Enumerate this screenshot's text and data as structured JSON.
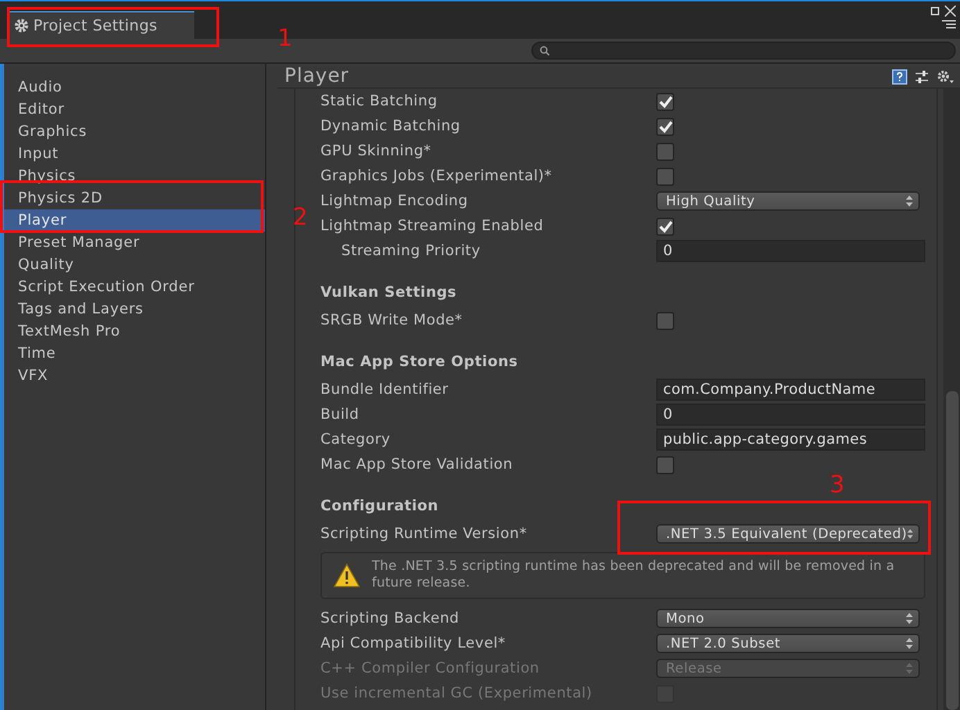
{
  "window": {
    "tab": "Project Settings"
  },
  "sidebar": {
    "items": [
      {
        "label": "Audio",
        "selected": false
      },
      {
        "label": "Editor",
        "selected": false
      },
      {
        "label": "Graphics",
        "selected": false
      },
      {
        "label": "Input",
        "selected": false
      },
      {
        "label": "Physics",
        "selected": false
      },
      {
        "label": "Physics 2D",
        "selected": false
      },
      {
        "label": "Player",
        "selected": true
      },
      {
        "label": "Preset Manager",
        "selected": false
      },
      {
        "label": "Quality",
        "selected": false
      },
      {
        "label": "Script Execution Order",
        "selected": false
      },
      {
        "label": "Tags and Layers",
        "selected": false
      },
      {
        "label": "TextMesh Pro",
        "selected": false
      },
      {
        "label": "Time",
        "selected": false
      },
      {
        "label": "VFX",
        "selected": false
      }
    ]
  },
  "inspector": {
    "title": "Player",
    "rows": [
      {
        "kind": "checkbox",
        "label": "Static Batching",
        "checked": true,
        "disabled": false
      },
      {
        "kind": "checkbox",
        "label": "Dynamic Batching",
        "checked": true,
        "disabled": false
      },
      {
        "kind": "checkbox",
        "label": "GPU Skinning*",
        "checked": false,
        "disabled": false
      },
      {
        "kind": "checkbox",
        "label": "Graphics Jobs (Experimental)*",
        "checked": false,
        "disabled": false
      },
      {
        "kind": "dropdown",
        "label": "Lightmap Encoding",
        "value": "High Quality",
        "disabled": false
      },
      {
        "kind": "checkbox",
        "label": "Lightmap Streaming Enabled",
        "checked": true,
        "disabled": false
      },
      {
        "kind": "text",
        "label": "Streaming Priority",
        "value": "0",
        "indented": true,
        "disabled": false
      },
      {
        "kind": "header",
        "label": "Vulkan Settings"
      },
      {
        "kind": "checkbox",
        "label": "SRGB Write Mode*",
        "checked": false,
        "disabled": false
      },
      {
        "kind": "header",
        "label": "Mac App Store Options"
      },
      {
        "kind": "text",
        "label": "Bundle Identifier",
        "value": "com.Company.ProductName",
        "disabled": false
      },
      {
        "kind": "text",
        "label": "Build",
        "value": "0",
        "disabled": false
      },
      {
        "kind": "text",
        "label": "Category",
        "value": "public.app-category.games",
        "disabled": false
      },
      {
        "kind": "checkbox",
        "label": "Mac App Store Validation",
        "checked": false,
        "disabled": false
      },
      {
        "kind": "header",
        "label": "Configuration"
      },
      {
        "kind": "dropdown",
        "label": "Scripting Runtime Version*",
        "value": ".NET 3.5 Equivalent (Deprecated)",
        "disabled": false
      },
      {
        "kind": "warning",
        "label": "The .NET 3.5 scripting runtime has been deprecated and will be removed in a future release."
      },
      {
        "kind": "dropdown",
        "label": "Scripting Backend",
        "value": "Mono",
        "disabled": false
      },
      {
        "kind": "dropdown",
        "label": "Api Compatibility Level*",
        "value": ".NET 2.0 Subset",
        "disabled": false
      },
      {
        "kind": "dropdown",
        "label": "C++ Compiler Configuration",
        "value": "Release",
        "disabled": true
      },
      {
        "kind": "checkbox",
        "label": "Use incremental GC (Experimental)",
        "checked": false,
        "disabled": true
      }
    ]
  },
  "annotations": [
    {
      "label": "1"
    },
    {
      "label": "2"
    },
    {
      "label": "3"
    }
  ]
}
